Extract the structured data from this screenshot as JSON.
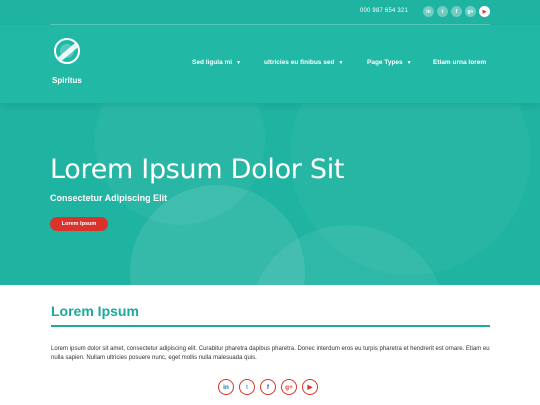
{
  "header": {
    "phone": "000 987 654 321",
    "brand": "Spiritus",
    "social_icons": [
      "linkedin-icon",
      "twitter-icon",
      "facebook-icon",
      "google-plus-icon",
      "youtube-icon"
    ],
    "nav": [
      {
        "label": "Sed ligula mi",
        "has_dropdown": true
      },
      {
        "label": "ultricies eu finibus sed",
        "has_dropdown": true
      },
      {
        "label": "Page Types",
        "has_dropdown": true
      },
      {
        "label": "Etiam urna lorem",
        "has_dropdown": false
      }
    ]
  },
  "hero": {
    "title": "Lorem Ipsum Dolor Sit",
    "subtitle": "Consectetur Adipiscing Elit",
    "button_label": "Lorem Ipsum"
  },
  "section": {
    "title": "Lorem Ipsum",
    "body": "Lorem ipsum dolor sit amet, consectetur adipiscing elit. Curabitur pharetra dapibus pharetra. Donec interdum eros eu turpis pharetra et hendrerit est ornare. Etiam eu nulla sapien. Nullam ultricies posuere nunc, eget mollis nulla malesuada quis."
  },
  "footer": {
    "social_icons": [
      "linkedin-icon",
      "twitter-icon",
      "facebook-icon",
      "google-plus-icon",
      "youtube-icon"
    ]
  },
  "colors": {
    "hero_bg": "#1fb3a1",
    "accent": "#1aa99a",
    "button": "#d9342b"
  }
}
